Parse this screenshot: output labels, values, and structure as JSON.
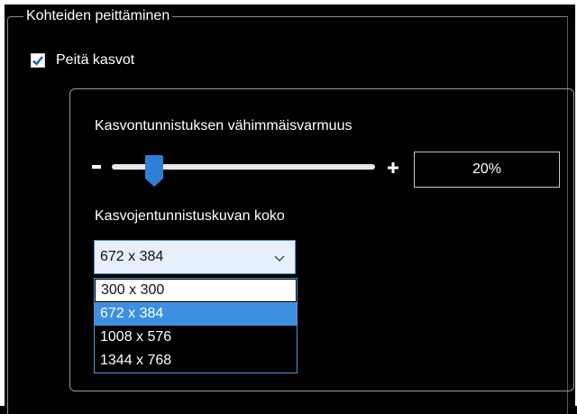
{
  "group": {
    "title": "Kohteiden peittäminen"
  },
  "hide_faces": {
    "label": "Peitä kasvot",
    "checked": true
  },
  "confidence": {
    "label": "Kasvontunnistuksen vähimmäisvarmuus",
    "value_text": "20%",
    "slider_value_percent": 20
  },
  "image_size": {
    "label": "Kasvojentunnistuskuvan koko",
    "selected": "672 x 384",
    "options": [
      "300 x 300",
      "672 x 384",
      "1008 x 576",
      "1344 x 768"
    ],
    "highlighted_index": 1
  },
  "colors": {
    "background": "#000000",
    "accent": "#3d8fe0",
    "select_bg": "#e6f0fb"
  },
  "icons": {
    "checkbox": "checkmark-icon",
    "decrease": "minus-icon",
    "increase": "plus-icon",
    "dropdown": "chevron-down-icon"
  }
}
